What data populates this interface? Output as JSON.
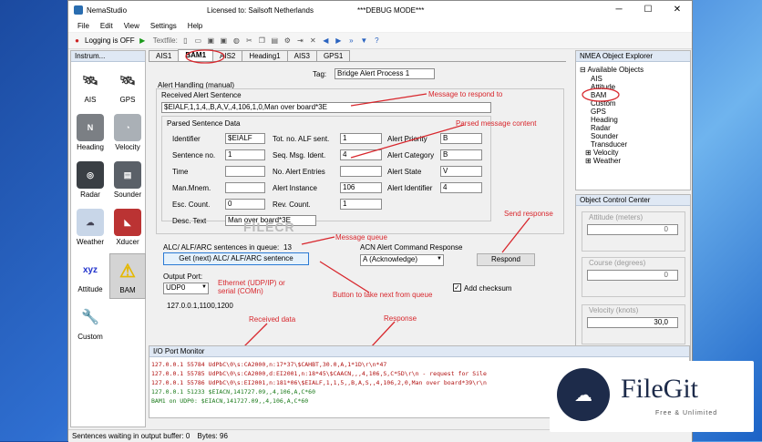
{
  "window": {
    "app": "NemaStudio",
    "license": "Licensed to: Sailsoft Netherlands",
    "mode": "***DEBUG MODE***"
  },
  "menu": [
    "File",
    "Edit",
    "View",
    "Settings",
    "Help"
  ],
  "toolbar": {
    "logging": "Logging is OFF",
    "textfile": "Textfile:"
  },
  "instruments": {
    "title": "Instrum...",
    "items": [
      "AIS",
      "GPS",
      "Heading",
      "Velocity",
      "Radar",
      "Sounder",
      "Weather",
      "Xducer",
      "Attitude",
      "BAM",
      "Custom"
    ]
  },
  "tabs": [
    "AIS1",
    "BAM1",
    "AIS2",
    "Heading1",
    "AIS3",
    "GPS1"
  ],
  "bam": {
    "tag_label": "Tag:",
    "tag_value": "Bridge Alert Process 1",
    "alert_handling": "Alert Handling (manual)",
    "received_label": "Received Alert Sentence",
    "received_value": "$EIALF,1,1,4,,B,A,V,,4,106,1,0,Man over board*3E",
    "parsed_label": "Parsed Sentence Data",
    "identifier_label": "Identifier",
    "identifier_value": "$EIALF",
    "tot_label": "Tot. no. ALF sent.",
    "tot_value": "1",
    "priority_label": "Alert Priority",
    "priority_value": "B",
    "sentno_label": "Sentence no.",
    "sentno_value": "1",
    "seq_label": "Seq. Msg. Ident.",
    "seq_value": "4",
    "category_label": "Alert Category",
    "category_value": "B",
    "time_label": "Time",
    "time_value": "",
    "entries_label": "No. Alert Entries",
    "entries_value": "",
    "state_label": "Alert State",
    "state_value": "V",
    "mnem_label": "Man.Mnem.",
    "mnem_value": "",
    "instance_label": "Alert Instance",
    "instance_value": "106",
    "alertid_label": "Alert Identifier",
    "alertid_value": "4",
    "esc_label": "Esc. Count.",
    "esc_value": "0",
    "rev_label": "Rev. Count.",
    "rev_value": "1",
    "desc_label": "Desc. Text",
    "desc_value": "Man over board*3E",
    "queue_label": "ALC/ ALF/ARC sentences in queue:",
    "queue_count": "13",
    "get_next_button": "Get (next) ALC/ ALF/ARC sentence",
    "acn_label": "ACN Alert Command Response",
    "acn_value": "A (Acknowledge)",
    "respond_button": "Respond",
    "port_label": "Output Port:",
    "port_value": "UDP0",
    "add_checksum": "Add checksum",
    "address": "127.0.0.1,1100,1200"
  },
  "annotations": {
    "msg_respond": "Message to respond to",
    "parsed": "Parsed message content",
    "send_response": "Send response",
    "queue": "Message queue",
    "ethernet": "Ethernet (UDP/IP) or\nserial (COMn)",
    "take_next": "Button to take next from queue",
    "received": "Received data",
    "response": "Response"
  },
  "watermark": "FILECR",
  "nmea": {
    "title": "NMEA Object Explorer",
    "root": "Available Objects",
    "items": [
      "AIS",
      "Attitude",
      "BAM",
      "Custom",
      "GPS",
      "Heading",
      "Radar",
      "Sounder",
      "Transducer",
      "Velocity",
      "Weather"
    ]
  },
  "occ": {
    "title": "Object Control Center",
    "attitude": "Attitude (meters)",
    "attitude_value": "0",
    "course": "Course (degrees)",
    "course_value": "0",
    "velocity": "Velocity (knots)",
    "velocity_value": "30,0"
  },
  "io": {
    "title": "I/O Port Monitor",
    "lines": [
      "127.0.0.1 55784 UdPbC\\0\\s:CA2000,n:17*37\\$CAHBT,30.0,A,1*1D\\r\\n*47",
      "127.0.0.1 55785 UdPbC\\0\\s:CA2000,d:EI2001,n:18*45\\$CAACN,,,4,106,S,C*5D\\r\\n  - request for Sile",
      "127.0.0.1 55786 UdPbC\\0\\s:EI2001,n:181*06\\$EIALF,1,1,5,,B,A,S,,4,106,2,0,Man over board*39\\r\\n",
      "127.0.0.1 51233 $EIACN,141727.09,,4,106,A,C*60",
      "BAM1 on UDP0: $EIACN,141727.09,,4,106,A,C*60"
    ]
  },
  "status": {
    "label": "Sentences waiting in output buffer:",
    "count": "0",
    "bytes_label": "Bytes:",
    "bytes": "96"
  },
  "brand": {
    "name": "FileGit",
    "tag": "Free & Unlimited"
  },
  "colors": {
    "annotation": "#d8272d",
    "io_green": "#1a7a1a",
    "io_red": "#b01010"
  }
}
